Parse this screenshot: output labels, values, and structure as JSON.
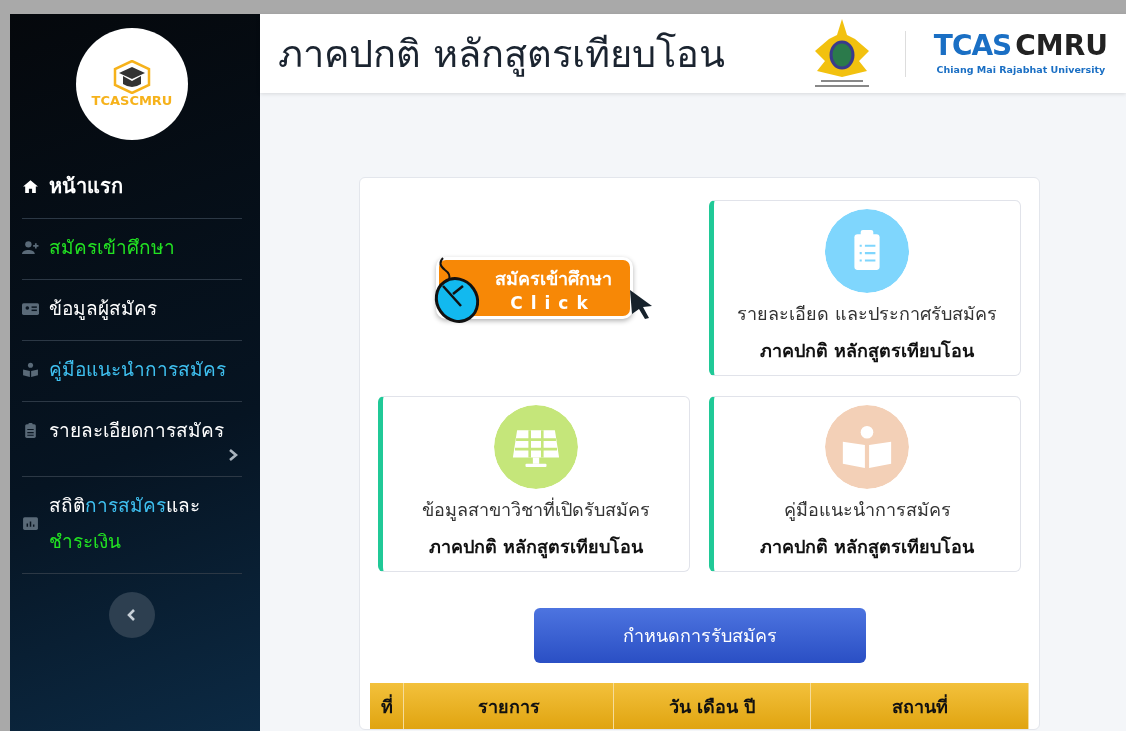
{
  "sidebar": {
    "logo": {
      "text": "TCASCMRU"
    },
    "items": [
      {
        "kind": "home",
        "segments": [
          {
            "text": "หน้าแรก",
            "color": "#ffffff"
          }
        ],
        "chevron": false
      },
      {
        "kind": "user-plus",
        "segments": [
          {
            "text": "สมัครเข้าศึกษา",
            "color": "#22e222"
          }
        ],
        "chevron": false
      },
      {
        "kind": "id-card",
        "segments": [
          {
            "text": "ข้อมูลผู้สมัคร",
            "color": "#ffffff"
          }
        ],
        "chevron": false
      },
      {
        "kind": "book-reader",
        "segments": [
          {
            "text": "คู่มือแนะนำการสมัคร",
            "color": "#3fc0f0"
          }
        ],
        "chevron": false
      },
      {
        "kind": "clipboard",
        "segments": [
          {
            "text": "รายละเอียดการสมัคร",
            "color": "#ffffff"
          }
        ],
        "chevron": true
      },
      {
        "kind": "chart",
        "segments": [
          {
            "text": "สถิติ",
            "color": "#ffffff"
          },
          {
            "text": "การสมัคร",
            "color": "#3fc0f0"
          },
          {
            "text": "และ",
            "color": "#ffffff"
          },
          {
            "text": "ชำระเงิน",
            "color": "#22e222"
          }
        ],
        "chevron": false
      }
    ]
  },
  "header": {
    "title": "ภาคปกติ หลักสูตรเทียบโอน",
    "brand": {
      "left": "TCAS",
      "right": "CMRU",
      "subtitle": "Chiang Mai Rajabhat University"
    }
  },
  "apply_banner": {
    "title": "สมัครเข้าศึกษา",
    "action": "Click"
  },
  "cards": [
    {
      "kind": "clipboard",
      "color": "#7fd6fd",
      "line1": "รายละเอียด และประกาศรับสมัคร",
      "line2": "ภาคปกติ หลักสูตรเทียบโอน"
    },
    {
      "kind": "board",
      "color": "#c5e67a",
      "line1": "ข้อมูลสาขาวิชาที่เปิดรับสมัคร",
      "line2": "ภาคปกติ หลักสูตรเทียบโอน"
    },
    {
      "kind": "book",
      "color": "#f3d0b7",
      "line1": "คู่มือแนะนำการสมัคร",
      "line2": "ภาคปกติ หลักสูตรเทียบโอน"
    }
  ],
  "schedule_button": "กำหนดการรับสมัคร",
  "table": {
    "columns": [
      "ที่",
      "รายการ",
      "วัน เดือน ปี",
      "สถานที่"
    ]
  }
}
